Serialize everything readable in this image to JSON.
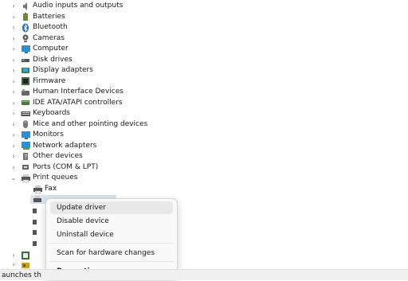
{
  "tree": {
    "categories": [
      {
        "label": "Audio inputs and outputs",
        "icon": "speaker-icon"
      },
      {
        "label": "Batteries",
        "icon": "battery-icon"
      },
      {
        "label": "Bluetooth",
        "icon": "bluetooth-icon"
      },
      {
        "label": "Cameras",
        "icon": "camera-icon"
      },
      {
        "label": "Computer",
        "icon": "computer-icon"
      },
      {
        "label": "Disk drives",
        "icon": "disk-drive-icon"
      },
      {
        "label": "Display adapters",
        "icon": "display-adapter-icon"
      },
      {
        "label": "Firmware",
        "icon": "firmware-icon"
      },
      {
        "label": "Human Interface Devices",
        "icon": "hid-icon"
      },
      {
        "label": "IDE ATA/ATAPI controllers",
        "icon": "ide-controller-icon"
      },
      {
        "label": "Keyboards",
        "icon": "keyboard-icon"
      },
      {
        "label": "Mice and other pointing devices",
        "icon": "mouse-icon"
      },
      {
        "label": "Monitors",
        "icon": "monitor-icon"
      },
      {
        "label": "Network adapters",
        "icon": "network-adapter-icon"
      },
      {
        "label": "Other devices",
        "icon": "unknown-device-icon"
      },
      {
        "label": "Ports (COM & LPT)",
        "icon": "port-icon"
      },
      {
        "label": "Print queues",
        "icon": "printer-icon"
      }
    ],
    "print_queue_children": [
      {
        "label": "Fax",
        "icon": "fax-printer-icon"
      }
    ]
  },
  "context_menu": {
    "update_driver": "Update driver",
    "disable_device": "Disable device",
    "uninstall_device": "Uninstall device",
    "scan_hardware": "Scan for hardware changes",
    "properties": "Properties"
  },
  "status_bar": {
    "text": "aunches th"
  },
  "colors": {
    "selection": "#d9e3ee",
    "menu_bg": "#f9f9f9",
    "menu_hover": "#e8e8e8",
    "accent_blue": "#0a64c8"
  }
}
